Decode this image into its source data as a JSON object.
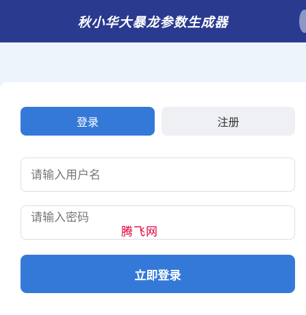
{
  "header": {
    "title": "秋小华大暴龙参数生成器"
  },
  "tabs": {
    "login": "登录",
    "register": "注册"
  },
  "form": {
    "username_placeholder": "请输入用户名",
    "password_placeholder": "请输入密码",
    "overlay_text": "腾飞网"
  },
  "submit": {
    "label": "立即登录"
  },
  "colors": {
    "header_bg": "#293a8f",
    "accent": "#3479d8",
    "overlay_text": "#e0003c",
    "page_bg": "#eef4fb"
  }
}
